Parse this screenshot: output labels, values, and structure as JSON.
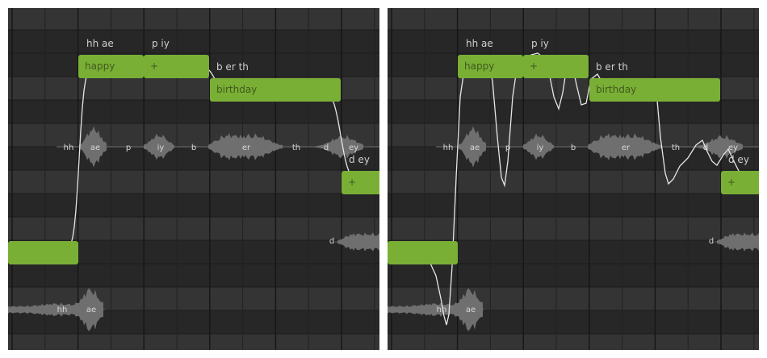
{
  "colors": {
    "panel_bg": "#2a2a2a",
    "row_light": "#343434",
    "row_dark": "#272727",
    "grid_line": "#1b1b1b",
    "note_fill": "#7aaf36",
    "note_text": "#3f5a1b",
    "pitch_curve": "#e6e6e6",
    "waveform": "#6f6f6f"
  },
  "panels": [
    {
      "name": "left",
      "notes": [
        {
          "name": "low",
          "lyric": "",
          "phonemes": ""
        },
        {
          "name": "happy",
          "lyric": "happy",
          "phonemes": "hh ae"
        },
        {
          "name": "plus1",
          "lyric": "+",
          "phonemes": "p iy"
        },
        {
          "name": "birthday",
          "lyric": "birthday",
          "phonemes": "b er th"
        },
        {
          "name": "plus2",
          "lyric": "+",
          "phonemes": "d ey"
        }
      ],
      "wave_labels_main": [
        "hh",
        "ae",
        "p",
        "iy",
        "b",
        "er",
        "th",
        "d",
        "ey"
      ],
      "wave_labels_low": [
        "hh",
        "ae"
      ],
      "wave_labels_right": [
        "d"
      ]
    },
    {
      "name": "right",
      "notes": [
        {
          "name": "low",
          "lyric": "",
          "phonemes": ""
        },
        {
          "name": "happy",
          "lyric": "happy",
          "phonemes": "hh ae"
        },
        {
          "name": "plus1",
          "lyric": "+",
          "phonemes": "p iy"
        },
        {
          "name": "birthday",
          "lyric": "birthday",
          "phonemes": "b er th"
        },
        {
          "name": "plus2",
          "lyric": "+",
          "phonemes": "d ey"
        }
      ],
      "wave_labels_main": [
        "hh",
        "ae",
        "p",
        "iy",
        "b",
        "er",
        "th",
        "d",
        "ey"
      ],
      "wave_labels_low": [
        "hh",
        "ae"
      ],
      "wave_labels_right": [
        "d"
      ]
    }
  ]
}
